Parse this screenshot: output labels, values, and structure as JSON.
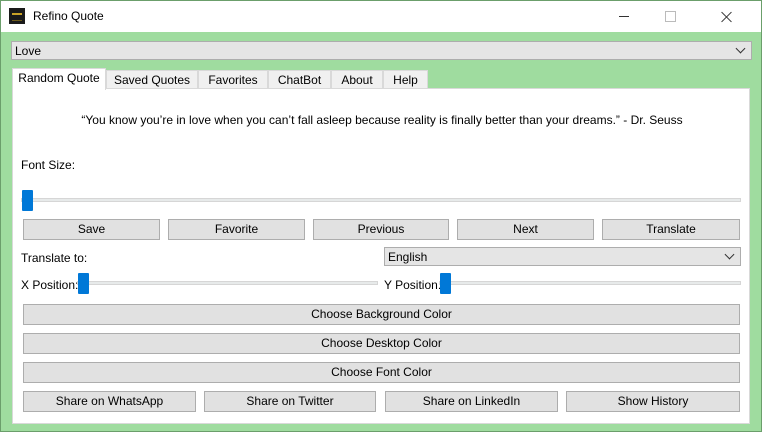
{
  "window": {
    "title": "Refino Quote"
  },
  "category_select": {
    "value": "Love"
  },
  "tabs": [
    {
      "label": "Random Quote",
      "active": true
    },
    {
      "label": "Saved Quotes",
      "active": false
    },
    {
      "label": "Favorites",
      "active": false
    },
    {
      "label": "ChatBot",
      "active": false
    },
    {
      "label": "About",
      "active": false
    },
    {
      "label": "Help",
      "active": false
    }
  ],
  "quote": {
    "text": "“You know you’re in love when you can’t fall asleep because reality is finally better than your dreams.” - Dr. Seuss"
  },
  "font_size": {
    "label": "Font Size:",
    "value_fraction": 0.0
  },
  "actions": {
    "save": "Save",
    "favorite": "Favorite",
    "previous": "Previous",
    "next": "Next",
    "translate": "Translate"
  },
  "translate_to": {
    "label": "Translate to:",
    "value": "English"
  },
  "x_position": {
    "label": "X Position:",
    "value_fraction": 0.0
  },
  "y_position": {
    "label": "Y Position:",
    "value_fraction": 0.0
  },
  "colors_buttons": {
    "background": "Choose Background Color",
    "desktop": "Choose Desktop Color",
    "font": "Choose Font Color"
  },
  "share": {
    "whatsapp": "Share on WhatsApp",
    "twitter": "Share on Twitter",
    "linkedin": "Share on LinkedIn",
    "history": "Show History"
  },
  "theme": {
    "background": "#9fdc9f",
    "accent": "#0078d7"
  }
}
